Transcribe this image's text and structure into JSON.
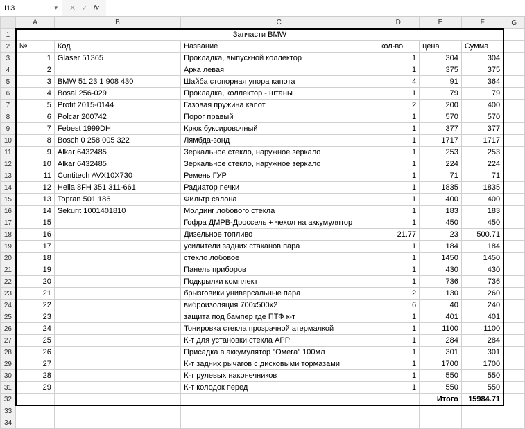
{
  "app": {
    "cell_ref": "I13",
    "formula_value": ""
  },
  "icons": {
    "dropdown": "▾",
    "cancel": "✕",
    "confirm": "✓",
    "fx": "fx"
  },
  "columns": [
    "A",
    "B",
    "C",
    "D",
    "E",
    "F",
    "G"
  ],
  "selected": {
    "col": "I",
    "row": 13
  },
  "sheet": {
    "title": "Запчасти BMW",
    "headers": {
      "no": "№",
      "code": "Код",
      "name": "Название",
      "qty": "кол-во",
      "price": "цена",
      "sum": "Сумма"
    },
    "rows": [
      {
        "no": 1,
        "code": "Glaser 51365",
        "name": "Прокладка, выпускной коллектор",
        "qty": 1,
        "price": 304,
        "sum": 304
      },
      {
        "no": 2,
        "code": "",
        "name": "Арка левая",
        "qty": 1,
        "price": 375,
        "sum": 375
      },
      {
        "no": 3,
        "code": "BMW 51 23 1 908 430",
        "name": "Шайба стопорная упора капота",
        "qty": 4,
        "price": 91,
        "sum": 364
      },
      {
        "no": 4,
        "code": "Bosal 256-029",
        "name": "Прокладка, коллектор - штаны",
        "qty": 1,
        "price": 79,
        "sum": 79
      },
      {
        "no": 5,
        "code": "Profit 2015-0144",
        "name": "Газовая пружина капот",
        "qty": 2,
        "price": 200,
        "sum": 400
      },
      {
        "no": 6,
        "code": "Polcar 200742",
        "name": "Порог правый",
        "qty": 1,
        "price": 570,
        "sum": 570
      },
      {
        "no": 7,
        "code": "Febest 1999DH",
        "name": "Крюк буксировочный",
        "qty": 1,
        "price": 377,
        "sum": 377
      },
      {
        "no": 8,
        "code": "Bosch 0 258 005 322",
        "name": "Лямбда-зонд",
        "qty": 1,
        "price": 1717,
        "sum": 1717
      },
      {
        "no": 9,
        "code": "Alkar 6432485",
        "name": "Зеркальное стекло, наружное зеркало",
        "qty": 1,
        "price": 253,
        "sum": 253
      },
      {
        "no": 10,
        "code": "Alkar 6432485",
        "name": "Зеркальное стекло, наружное зеркало",
        "qty": 1,
        "price": 224,
        "sum": 224
      },
      {
        "no": 11,
        "code": "Contitech AVX10X730",
        "name": "Ремень ГУР",
        "qty": 1,
        "price": 71,
        "sum": 71
      },
      {
        "no": 12,
        "code": "Hella 8FH 351 311-661",
        "name": "Радиатор печки",
        "qty": 1,
        "price": 1835,
        "sum": 1835
      },
      {
        "no": 13,
        "code": "Topran 501 186",
        "name": "Фильтр салона",
        "qty": 1,
        "price": 400,
        "sum": 400
      },
      {
        "no": 14,
        "code": "Sekurit 1001401810",
        "name": "Молдинг лобового стекла",
        "qty": 1,
        "price": 183,
        "sum": 183
      },
      {
        "no": 15,
        "code": "",
        "name": "Гофра ДМРВ-Дроссель + чехол на аккумулятор",
        "qty": 1,
        "price": 450,
        "sum": 450
      },
      {
        "no": 16,
        "code": "",
        "name": "Дизельное топливо",
        "qty": 21.77,
        "price": 23,
        "sum": 500.71
      },
      {
        "no": 17,
        "code": "",
        "name": "усилители задних стаканов пара",
        "qty": 1,
        "price": 184,
        "sum": 184
      },
      {
        "no": 18,
        "code": "",
        "name": "стекло лобовое",
        "qty": 1,
        "price": 1450,
        "sum": 1450
      },
      {
        "no": 19,
        "code": "",
        "name": "Панель приборов",
        "qty": 1,
        "price": 430,
        "sum": 430
      },
      {
        "no": 20,
        "code": "",
        "name": "Подкрылки комплект",
        "qty": 1,
        "price": 736,
        "sum": 736
      },
      {
        "no": 21,
        "code": "",
        "name": "брызговики универсальные пара",
        "qty": 2,
        "price": 130,
        "sum": 260
      },
      {
        "no": 22,
        "code": "",
        "name": "виброизоляция 700х500х2",
        "qty": 6,
        "price": 40,
        "sum": 240
      },
      {
        "no": 23,
        "code": "",
        "name": "защита под бампер где ПТФ к-т",
        "qty": 1,
        "price": 401,
        "sum": 401
      },
      {
        "no": 24,
        "code": "",
        "name": "Тонировка стекла прозрачной атермалкой",
        "qty": 1,
        "price": 1100,
        "sum": 1100
      },
      {
        "no": 25,
        "code": "",
        "name": "К-т для установки стекла APP",
        "qty": 1,
        "price": 284,
        "sum": 284
      },
      {
        "no": 26,
        "code": "",
        "name": "Присадка в аккумулятор \"Омега\" 100мл",
        "qty": 1,
        "price": 301,
        "sum": 301
      },
      {
        "no": 27,
        "code": "",
        "name": "К-т задних рычагов с дисковыми тормазами",
        "qty": 1,
        "price": 1700,
        "sum": 1700
      },
      {
        "no": 28,
        "code": "",
        "name": "К-т рулевых наконечников",
        "qty": 1,
        "price": 550,
        "sum": 550
      },
      {
        "no": 29,
        "code": "",
        "name": "К-т колодок перед",
        "qty": 1,
        "price": 550,
        "sum": 550
      }
    ],
    "total_label": "Итого",
    "total": 15984.71
  }
}
